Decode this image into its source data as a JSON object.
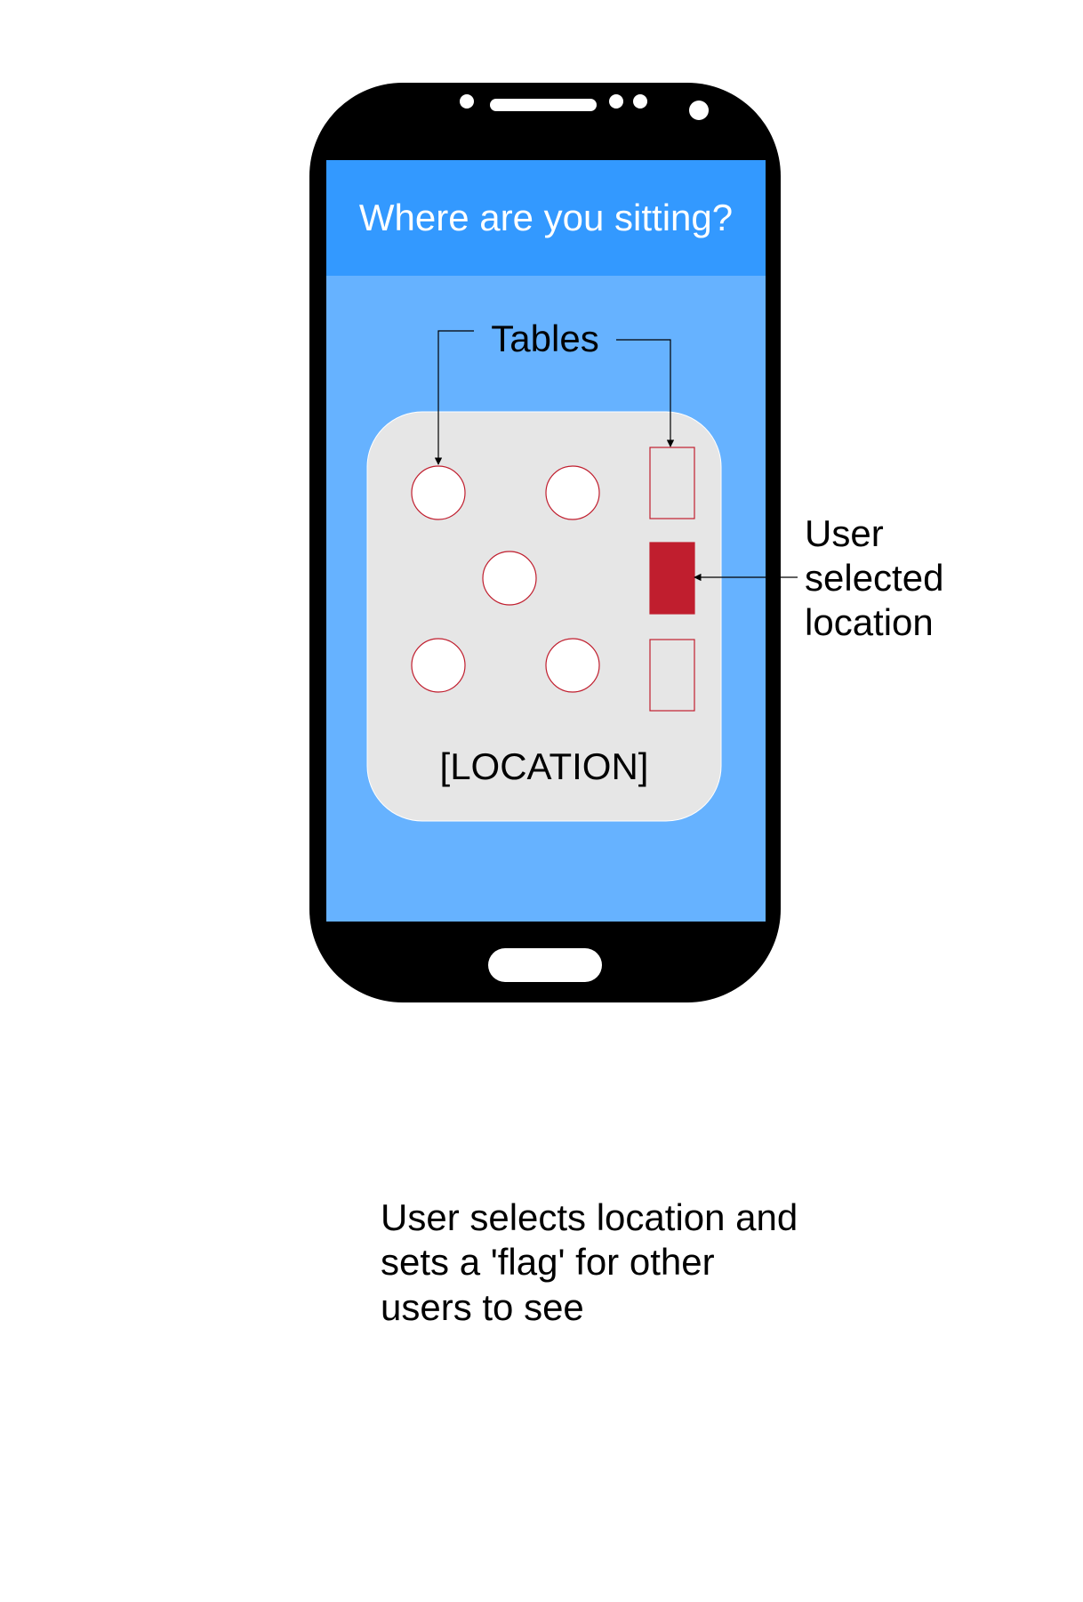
{
  "screen": {
    "header_title": "Where are you sitting?",
    "tables_label": "Tables",
    "location_label": "[LOCATION]"
  },
  "annotations": {
    "selected_location": [
      "User",
      "selected",
      "location"
    ],
    "caption": [
      "User selects location and",
      "sets a 'flag' for other",
      "users to see"
    ]
  },
  "tables": [
    {
      "shape": "round",
      "selected": false
    },
    {
      "shape": "round",
      "selected": false
    },
    {
      "shape": "square",
      "selected": false
    },
    {
      "shape": "round",
      "selected": false
    },
    {
      "shape": "square",
      "selected": true
    },
    {
      "shape": "round",
      "selected": false
    },
    {
      "shape": "round",
      "selected": false
    },
    {
      "shape": "square",
      "selected": false
    }
  ],
  "colors": {
    "phone_body": "#000000",
    "header_bg": "#3399FF",
    "screen_bg": "#66B2FF",
    "map_bg": "#E6E6E6",
    "table_outline": "#C01E2E",
    "selected_fill": "#C01E2E",
    "header_text": "#FFFFFF",
    "text": "#000000"
  }
}
